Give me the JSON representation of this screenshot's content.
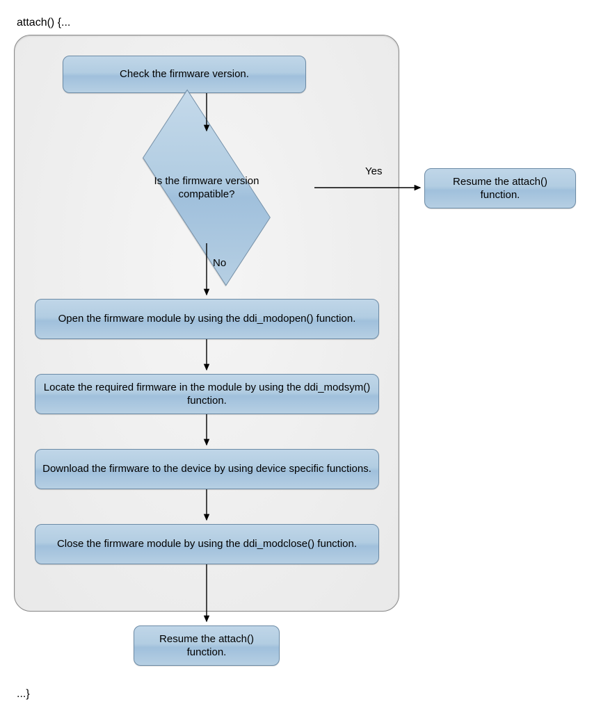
{
  "header": "attach() {...",
  "footer": "...}",
  "labels": {
    "yes": "Yes",
    "no": "No"
  },
  "nodes": {
    "check": "Check the firmware version.",
    "decision": "Is the firmware version compatible?",
    "resume_yes": "Resume the attach() function.",
    "open": "Open the firmware module by using the ddi_modopen() function.",
    "locate": "Locate the required firmware in the module by using the ddi_modsym() function.",
    "download": "Download the firmware to the device by using device specific functions.",
    "close": "Close the firmware module by using the ddi_modclose() function.",
    "resume_end": "Resume the attach() function."
  },
  "chart_data": {
    "type": "flowchart",
    "title": "attach() firmware loading flow",
    "nodes": [
      {
        "id": "A",
        "type": "process",
        "label": "Check the firmware version."
      },
      {
        "id": "B",
        "type": "decision",
        "label": "Is the firmware version compatible?"
      },
      {
        "id": "C",
        "type": "process",
        "label": "Resume the attach() function."
      },
      {
        "id": "D",
        "type": "process",
        "label": "Open the firmware module by using the ddi_modopen() function."
      },
      {
        "id": "E",
        "type": "process",
        "label": "Locate the required firmware in the module by using the ddi_modsym() function."
      },
      {
        "id": "F",
        "type": "process",
        "label": "Download the firmware to the device by using device specific functions."
      },
      {
        "id": "G",
        "type": "process",
        "label": "Close the firmware module by using the ddi_modclose() function."
      },
      {
        "id": "H",
        "type": "process",
        "label": "Resume the attach() function."
      }
    ],
    "edges": [
      {
        "from": "A",
        "to": "B",
        "label": ""
      },
      {
        "from": "B",
        "to": "C",
        "label": "Yes"
      },
      {
        "from": "B",
        "to": "D",
        "label": "No"
      },
      {
        "from": "D",
        "to": "E",
        "label": ""
      },
      {
        "from": "E",
        "to": "F",
        "label": ""
      },
      {
        "from": "F",
        "to": "G",
        "label": ""
      },
      {
        "from": "G",
        "to": "H",
        "label": ""
      }
    ],
    "container_group": [
      "A",
      "B",
      "D",
      "E",
      "F",
      "G"
    ]
  }
}
